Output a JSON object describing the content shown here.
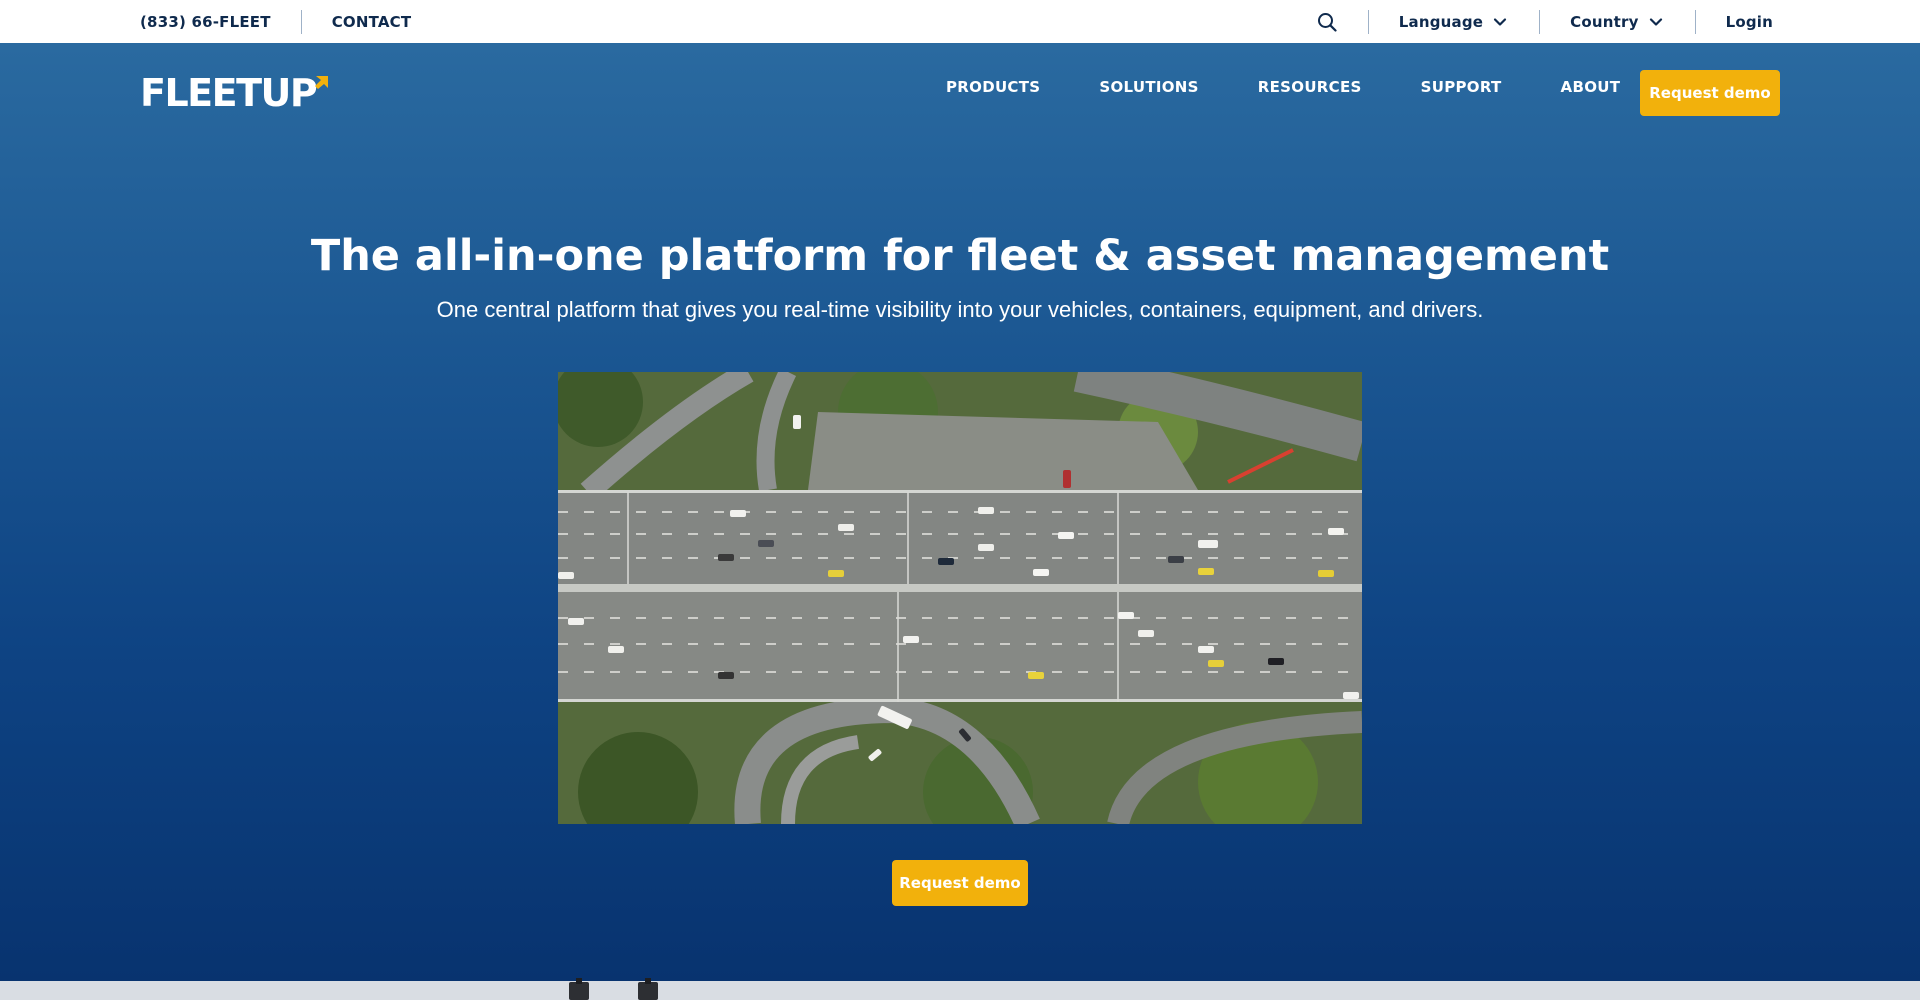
{
  "topbar": {
    "phone": "(833) 66-FLEET",
    "contact": "CONTACT",
    "language": "Language",
    "country": "Country",
    "login": "Login"
  },
  "header": {
    "logo_text": "FLEETUP",
    "nav": [
      "PRODUCTS",
      "SOLUTIONS",
      "RESOURCES",
      "SUPPORT",
      "ABOUT"
    ],
    "cta": "Request demo"
  },
  "hero": {
    "headline": "The all-in-one platform for fleet & asset management",
    "subheadline": "One central platform that gives you real-time visibility into your vehicles, containers, equipment, and drivers.",
    "cta": "Request demo"
  },
  "icons": {
    "search": "search-icon",
    "chevron": "chevron-down-icon",
    "logo_mark": "logo-arrow-icon"
  },
  "colors": {
    "brand_navy": "#0f2a4d",
    "hero_blue_top": "#2a6aa0",
    "hero_blue_bottom": "#08336f",
    "accent_yellow": "#f2b10c"
  }
}
